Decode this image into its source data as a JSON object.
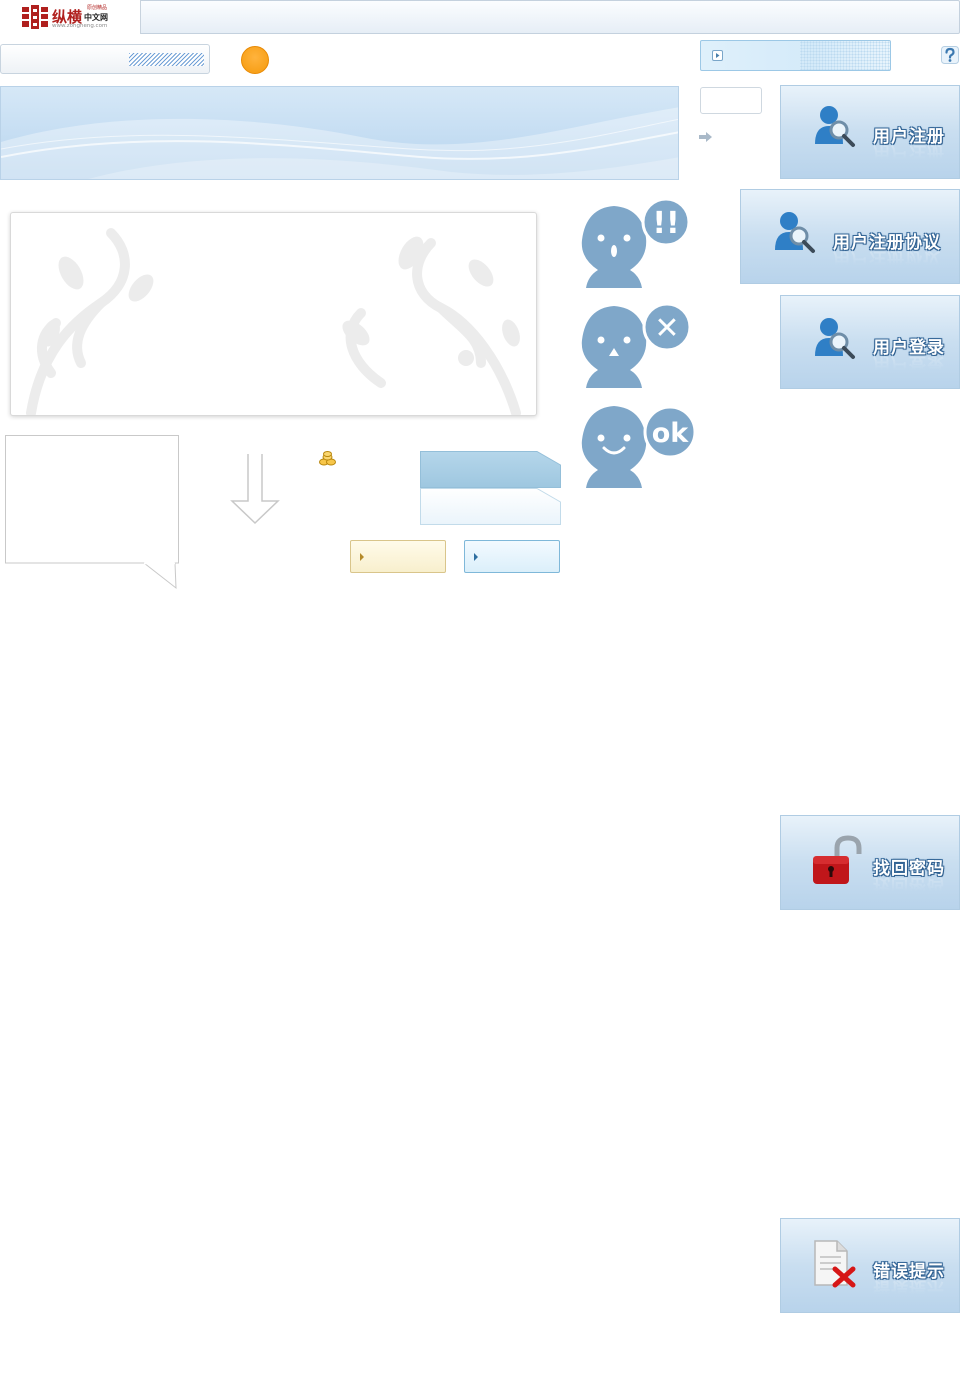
{
  "header": {
    "logo_text": "纵横",
    "logo_sub": "中文网",
    "logo_tagline": "原创精品",
    "logo_url": "www.zongheng.com"
  },
  "side_buttons": [
    {
      "label": "用户注册",
      "icon": "user-search-icon"
    },
    {
      "label": "用户注册协议",
      "icon": "user-search-icon"
    },
    {
      "label": "用户登录",
      "icon": "user-search-icon"
    },
    {
      "label": "找回密码",
      "icon": "unlock-icon"
    },
    {
      "label": "错误提示",
      "icon": "error-document-icon"
    }
  ],
  "status_faces": [
    {
      "bubble_text": "!!",
      "mood": "warning"
    },
    {
      "bubble_text": "✕",
      "mood": "error"
    },
    {
      "bubble_text": "ok",
      "mood": "success"
    }
  ],
  "colors": {
    "accent_blue": "#7fa7c9",
    "brand_red": "#b0201e",
    "orange": "#f59a0d"
  }
}
